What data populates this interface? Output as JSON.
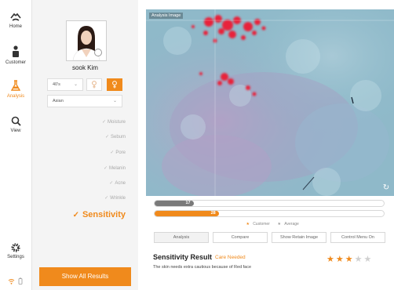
{
  "nav": {
    "items": [
      {
        "label": "Home",
        "icon": "home-icon"
      },
      {
        "label": "Customer",
        "icon": "person-icon"
      },
      {
        "label": "Analysis",
        "icon": "flask-icon"
      },
      {
        "label": "View",
        "icon": "magnifier-icon"
      }
    ],
    "settings_label": "Settings",
    "status_icons": [
      "wifi-icon",
      "battery-icon"
    ]
  },
  "profile": {
    "name": "sook Kim",
    "age_group": "40's",
    "race": "Asian",
    "gender_selected": "female"
  },
  "categories": [
    "Moisture",
    "Sebum",
    "Pore",
    "Melanin",
    "Acne",
    "Wrinkle"
  ],
  "selected_category": "Sensitivity",
  "show_all_label": "Show All Results",
  "image": {
    "label": "Analysis Image"
  },
  "bars": {
    "customer": {
      "value": 17,
      "fraction": 0.17
    },
    "average": {
      "value": 28,
      "fraction": 0.28
    }
  },
  "legend": {
    "customer": "Customer",
    "average": "Average"
  },
  "tabs": [
    "Analysis",
    "Compare",
    "Show Retain Image",
    "Control Menu On"
  ],
  "result": {
    "title": "Sensitivity Result",
    "status": "Care Needed",
    "stars_filled": 3,
    "stars_total": 5,
    "description": "The skin needs extra cautious because of Red face"
  },
  "colors": {
    "accent": "#f08a1c",
    "customer_bar": "#7a7a7a",
    "star_empty": "#d0d0d0"
  }
}
